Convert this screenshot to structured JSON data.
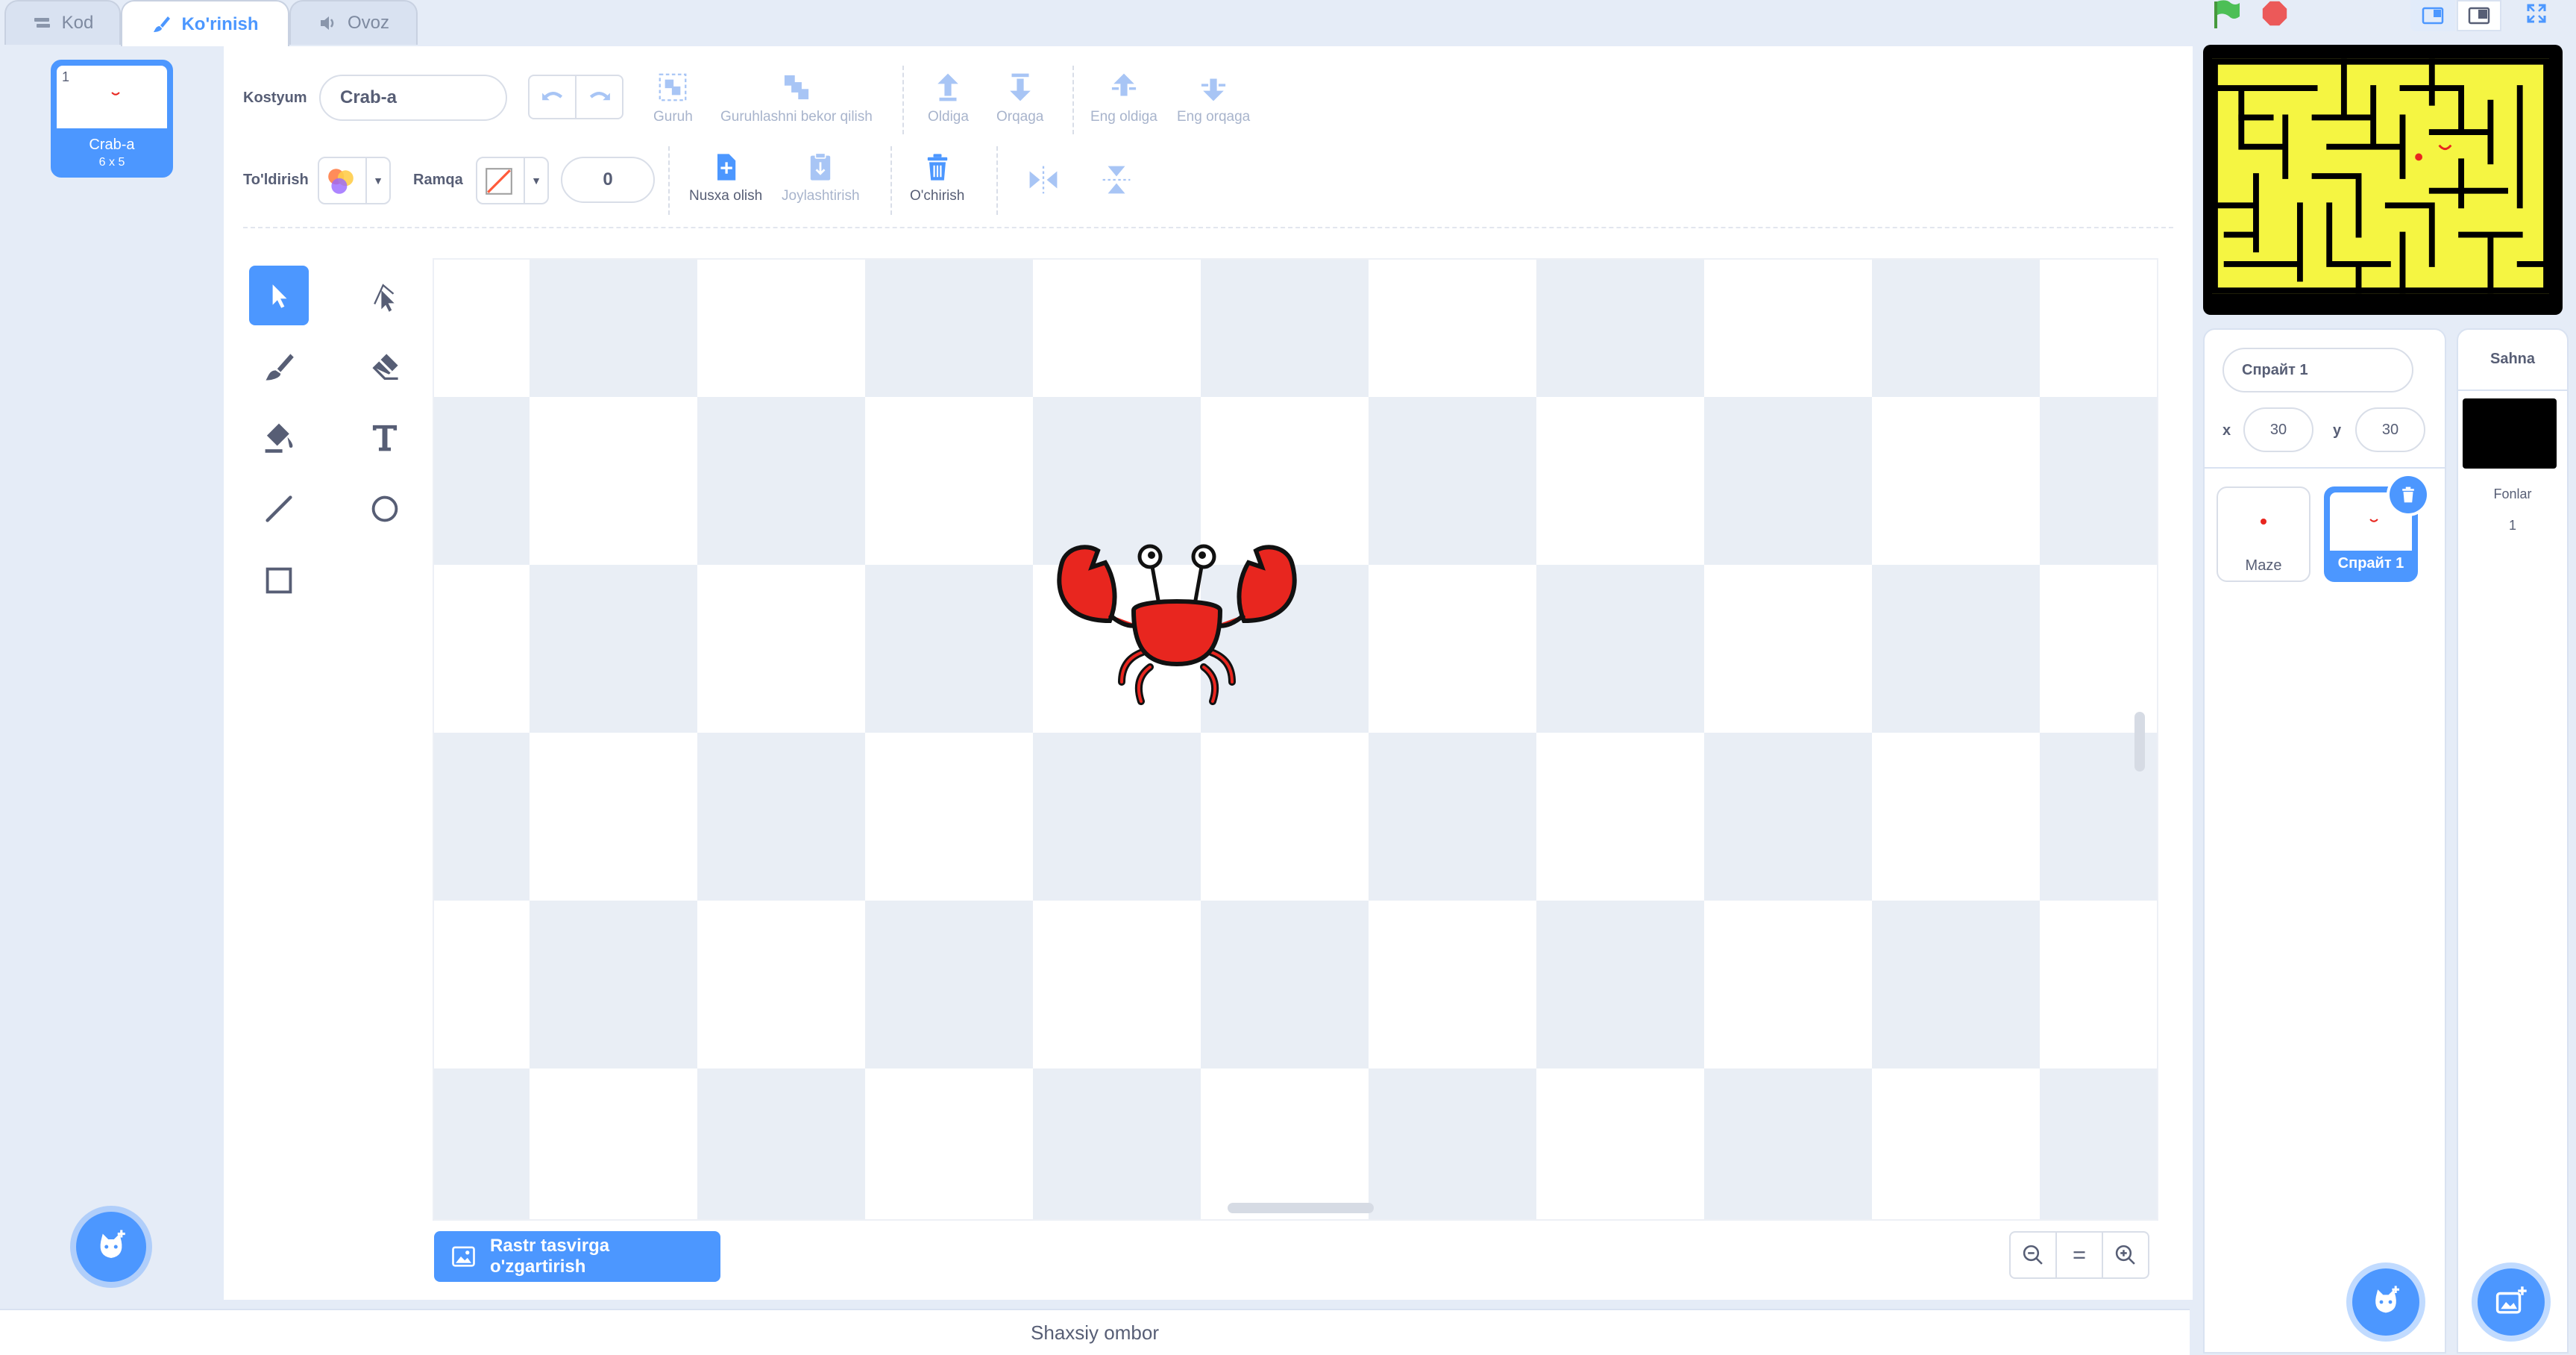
{
  "tabs": [
    {
      "label": "Kod",
      "icon": "code-icon"
    },
    {
      "label": "Ko'rinish",
      "icon": "brush-icon"
    },
    {
      "label": "Ovoz",
      "icon": "sound-icon"
    }
  ],
  "costume_list": {
    "items": [
      {
        "index": "1",
        "name": "Crab-a",
        "size": "6 x 5"
      }
    ],
    "add_icon": "cat-add-icon"
  },
  "editor": {
    "costume_label": "Kostyum",
    "costume_name": "Crab-a",
    "fill_label": "To'ldirish",
    "outline_label": "Ramqa",
    "outline_width": "0",
    "group": "Guruh",
    "ungroup": "Guruhlashni bekor qilish",
    "forward": "Oldiga",
    "backward": "Orqaga",
    "front": "Eng oldiga",
    "back": "Eng orqaga",
    "copy": "Nusxa olish",
    "paste": "Joylashtirish",
    "delete": "O'chirish",
    "convert_button": "Rastr tasvirga o'zgartirish"
  },
  "stage": {
    "sprite_name": "Спрайт 1",
    "x_label": "x",
    "x_value": "30",
    "y_label": "y",
    "y_value": "30",
    "sprites": [
      {
        "name": "Maze"
      },
      {
        "name": "Спрайт 1"
      }
    ],
    "stage_tab_title": "Sahna",
    "backdrops_label": "Fonlar",
    "backdrops_count": "1"
  },
  "footer": {
    "backpack": "Shaxsiy ombor"
  },
  "colors": {
    "accent": "#4c97ff",
    "maze_yellow": "#f5f542",
    "crab_red": "#e8261f"
  }
}
